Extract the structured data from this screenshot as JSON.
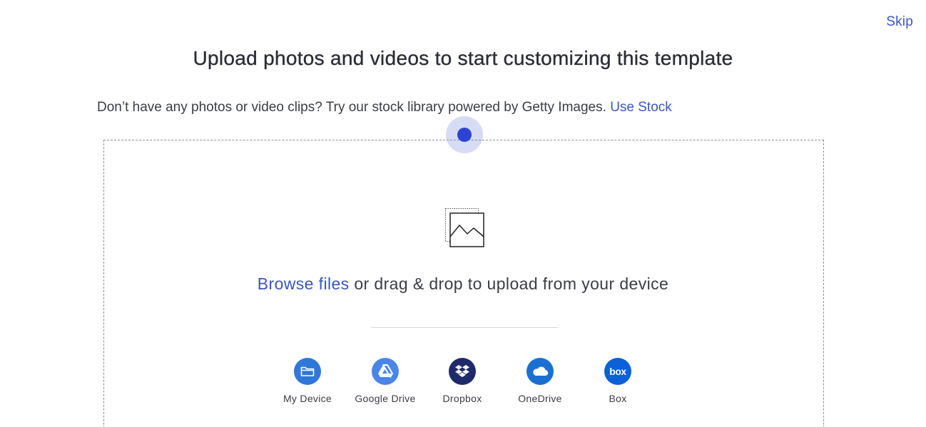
{
  "header": {
    "skip_label": "Skip",
    "title": "Upload photos and videos to start customizing this template"
  },
  "stock": {
    "prompt": "Don’t have any photos or video clips? Try our stock library powered by Getty Images.",
    "link_label": "Use Stock"
  },
  "dropzone": {
    "icon": "image-placeholder-icon",
    "browse_label": "Browse files",
    "drag_text": "or drag & drop to upload from your device"
  },
  "sources": [
    {
      "label": "My Device",
      "icon": "folder-icon",
      "color": "#2f78d8"
    },
    {
      "label": "Google Drive",
      "icon": "google-drive-icon",
      "color": "#4a86e8"
    },
    {
      "label": "Dropbox",
      "icon": "dropbox-icon",
      "color": "#1f2a6b"
    },
    {
      "label": "OneDrive",
      "icon": "cloud-icon",
      "color": "#1a6fd1"
    },
    {
      "label": "Box",
      "icon": "box-icon",
      "color": "#0b61d8"
    }
  ],
  "colors": {
    "link": "#3a56c2",
    "cursor": "#2d44d3"
  }
}
